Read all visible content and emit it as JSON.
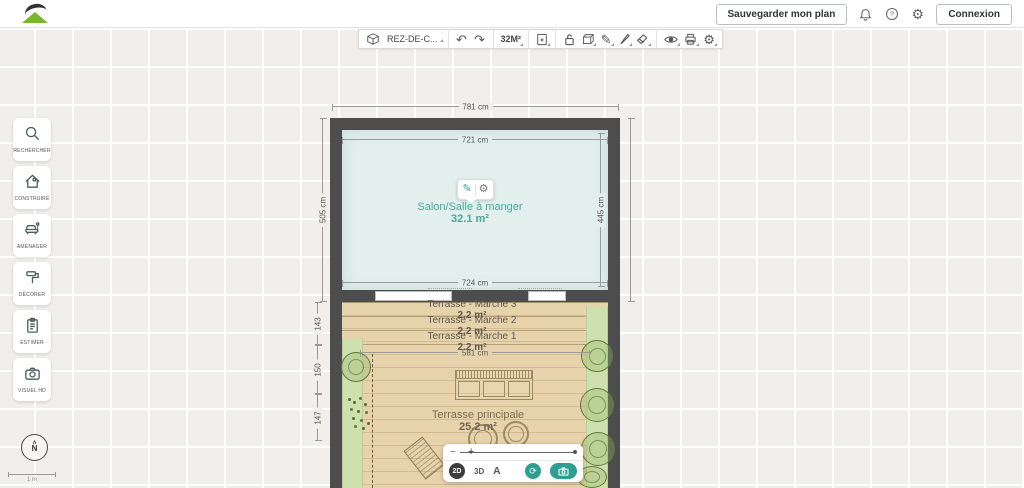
{
  "header": {
    "logo": "leroy-merlin",
    "save_button": "Sauvegarder mon plan",
    "connexion_button": "Connexion"
  },
  "toolbar": {
    "floor_selector": "REZ-DE-C...",
    "undo": "↶",
    "redo": "↷",
    "area_badge": "32M²",
    "gear_glyph": "⚙",
    "pencil_glyph": "✎"
  },
  "sidebar": {
    "items": [
      {
        "label": "RECHERCHER",
        "icon": "search-icon"
      },
      {
        "label": "CONSTRUIRE",
        "icon": "house-icon"
      },
      {
        "label": "AMÉNAGER",
        "icon": "sofa-icon"
      },
      {
        "label": "DÉCORER",
        "icon": "paint-roller-icon"
      },
      {
        "label": "ESTIMER",
        "icon": "clipboard-icon"
      },
      {
        "label": "VISUEL HD",
        "icon": "camera-icon"
      }
    ]
  },
  "plan": {
    "salon": {
      "name": "Salon/Salle à manger",
      "area": "32.1 m²"
    },
    "marches": [
      {
        "name": "Terrasse - Marche 3",
        "area": "2.2 m²"
      },
      {
        "name": "Terrasse - Marche 2",
        "area": "2.2 m²"
      },
      {
        "name": "Terrasse - Marche 1",
        "area": "2.2 m²"
      }
    ],
    "terrasse": {
      "name": "Terrasse principale",
      "area": "25.2 m²"
    },
    "dimensions": {
      "top_outer": "781 cm",
      "salon_inner_top": "721 cm",
      "salon_inner_bottom": "724 cm",
      "left_outer": "505 cm",
      "salon_inner_height": "445 cm",
      "terrace_width": "581 cm",
      "seg1": "143",
      "seg2": "150",
      "seg3": "147"
    }
  },
  "tooltip": {
    "edit_glyph": "✎",
    "gear_glyph": "⚙"
  },
  "bottom_toolbar": {
    "zoom_minus": "−",
    "zoom_handle": "+",
    "mode_2d": "2D",
    "mode_3d": "3D",
    "text_tool": "A",
    "rotate_glyph": "⟳"
  },
  "compass": {
    "chevron": "ᴧ",
    "label": "N"
  },
  "scale_bar": {
    "label": "1 m"
  },
  "colors": {
    "accent_teal": "#2f9e92",
    "brand_green": "#78b72a",
    "wall": "#4d4d4d",
    "salon_fill": "#e2efec",
    "terrace_fill": "#e7d3ab",
    "planter_fill": "#cfe0b0"
  }
}
